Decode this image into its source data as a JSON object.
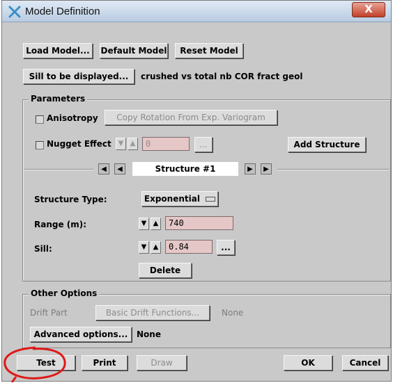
{
  "window": {
    "title": "Model Definition",
    "close_glyph": "X"
  },
  "toolbar": {
    "load_model": "Load Model...",
    "default_model": "Default Model",
    "reset_model": "Reset Model"
  },
  "sill_display": {
    "button": "Sill to be displayed...",
    "value": "crushed vs total nb COR fract geol"
  },
  "parameters": {
    "group_title": "Parameters",
    "anisotropy_label": "Anisotropy",
    "copy_rotation_button": "Copy Rotation From Exp. Variogram",
    "nugget_label": "Nugget Effect",
    "nugget_value": "0",
    "nugget_more_button": "...",
    "add_structure_button": "Add Structure",
    "structure_title": "Structure #1",
    "structure_type_label": "Structure Type:",
    "structure_type_value": "Exponential",
    "range_label": "Range (m):",
    "range_value": "740",
    "sill_label": "Sill:",
    "sill_value": "0.84",
    "sill_more_button": "...",
    "delete_button": "Delete"
  },
  "other_options": {
    "group_title": "Other Options",
    "drift_label": "Drift Part",
    "drift_button": "Basic Drift Functions...",
    "drift_value": "None",
    "advanced_button": "Advanced options...",
    "advanced_value": "None"
  },
  "footer": {
    "test": "Test",
    "print": "Print",
    "draw": "Draw",
    "ok": "OK",
    "cancel": "Cancel"
  },
  "colors": {
    "dialog_background": "#c9c9c9",
    "field_background": "#e5c7c7",
    "annotation_circle": "#e01818"
  }
}
